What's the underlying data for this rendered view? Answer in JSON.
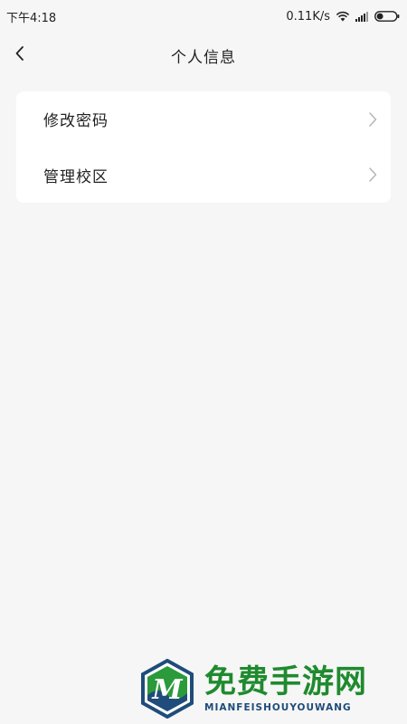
{
  "status_bar": {
    "time": "下午4:18",
    "speed": "0.11K/s"
  },
  "header": {
    "title": "个人信息",
    "back_icon": "back-chevron-icon"
  },
  "menu": {
    "items": [
      {
        "label": "修改密码",
        "icon": "chevron-right-icon"
      },
      {
        "label": "管理校区",
        "icon": "chevron-right-icon"
      }
    ]
  },
  "watermark": {
    "title": "免费手游网",
    "subtitle": "MIANFEISHOUYOUWANG",
    "logo_letter": "M",
    "colors": {
      "green": "#1f8a2e",
      "blue": "#1f4c7a"
    }
  }
}
